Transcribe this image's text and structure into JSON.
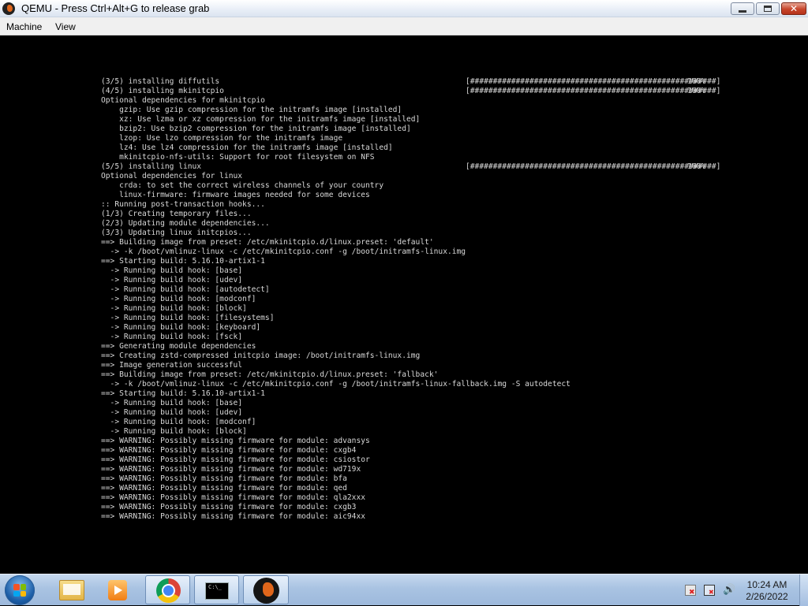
{
  "window": {
    "title": "QEMU - Press Ctrl+Alt+G to release grab",
    "close_glyph": "✕"
  },
  "menu": {
    "machine": "Machine",
    "view": "View"
  },
  "console": {
    "lines": [
      {
        "text": "(3/5) installing diffutils",
        "progress": "[######################################################] 100%"
      },
      {
        "text": "(4/5) installing mkinitcpio",
        "progress": "[######################################################] 100%"
      },
      {
        "text": "Optional dependencies for mkinitcpio"
      },
      {
        "text": "    gzip: Use gzip compression for the initramfs image [installed]"
      },
      {
        "text": "    xz: Use lzma or xz compression for the initramfs image [installed]"
      },
      {
        "text": "    bzip2: Use bzip2 compression for the initramfs image [installed]"
      },
      {
        "text": "    lzop: Use lzo compression for the initramfs image"
      },
      {
        "text": "    lz4: Use lz4 compression for the initramfs image [installed]"
      },
      {
        "text": "    mkinitcpio-nfs-utils: Support for root filesystem on NFS"
      },
      {
        "text": "(5/5) installing linux",
        "progress": "[######################################################] 100%"
      },
      {
        "text": "Optional dependencies for linux"
      },
      {
        "text": "    crda: to set the correct wireless channels of your country"
      },
      {
        "text": "    linux-firmware: firmware images needed for some devices"
      },
      {
        "text": ":: Running post-transaction hooks..."
      },
      {
        "text": "(1/3) Creating temporary files..."
      },
      {
        "text": "(2/3) Updating module dependencies..."
      },
      {
        "text": "(3/3) Updating linux initcpios..."
      },
      {
        "text": "==> Building image from preset: /etc/mkinitcpio.d/linux.preset: 'default'"
      },
      {
        "text": "  -> -k /boot/vmlinuz-linux -c /etc/mkinitcpio.conf -g /boot/initramfs-linux.img"
      },
      {
        "text": "==> Starting build: 5.16.10-artix1-1"
      },
      {
        "text": "  -> Running build hook: [base]"
      },
      {
        "text": "  -> Running build hook: [udev]"
      },
      {
        "text": "  -> Running build hook: [autodetect]"
      },
      {
        "text": "  -> Running build hook: [modconf]"
      },
      {
        "text": "  -> Running build hook: [block]"
      },
      {
        "text": "  -> Running build hook: [filesystems]"
      },
      {
        "text": "  -> Running build hook: [keyboard]"
      },
      {
        "text": "  -> Running build hook: [fsck]"
      },
      {
        "text": "==> Generating module dependencies"
      },
      {
        "text": "==> Creating zstd-compressed initcpio image: /boot/initramfs-linux.img"
      },
      {
        "text": "==> Image generation successful"
      },
      {
        "text": "==> Building image from preset: /etc/mkinitcpio.d/linux.preset: 'fallback'"
      },
      {
        "text": "  -> -k /boot/vmlinuz-linux -c /etc/mkinitcpio.conf -g /boot/initramfs-linux-fallback.img -S autodetect"
      },
      {
        "text": "==> Starting build: 5.16.10-artix1-1"
      },
      {
        "text": "  -> Running build hook: [base]"
      },
      {
        "text": "  -> Running build hook: [udev]"
      },
      {
        "text": "  -> Running build hook: [modconf]"
      },
      {
        "text": "  -> Running build hook: [block]"
      },
      {
        "text": "==> WARNING: Possibly missing firmware for module: advansys"
      },
      {
        "text": "==> WARNING: Possibly missing firmware for module: cxgb4"
      },
      {
        "text": "==> WARNING: Possibly missing firmware for module: csiostor"
      },
      {
        "text": "==> WARNING: Possibly missing firmware for module: wd719x"
      },
      {
        "text": "==> WARNING: Possibly missing firmware for module: bfa"
      },
      {
        "text": "==> WARNING: Possibly missing firmware for module: qed"
      },
      {
        "text": "==> WARNING: Possibly missing firmware for module: qla2xxx"
      },
      {
        "text": "==> WARNING: Possibly missing firmware for module: cxgb3"
      },
      {
        "text": "==> WARNING: Possibly missing firmware for module: aic94xx"
      }
    ]
  },
  "taskbar": {
    "apps": [
      {
        "name": "Windows Explorer",
        "icon": "folder-icon"
      },
      {
        "name": "Windows Media Player",
        "icon": "media-player-icon"
      },
      {
        "name": "Google Chrome",
        "icon": "chrome-icon"
      },
      {
        "name": "Command Prompt",
        "icon": "cmd-icon",
        "glyph": "C:\\_"
      },
      {
        "name": "QEMU",
        "icon": "qemu-icon"
      }
    ],
    "volume_glyph": "🔊",
    "clock": {
      "time": "10:24 AM",
      "date": "2/26/2022"
    }
  }
}
